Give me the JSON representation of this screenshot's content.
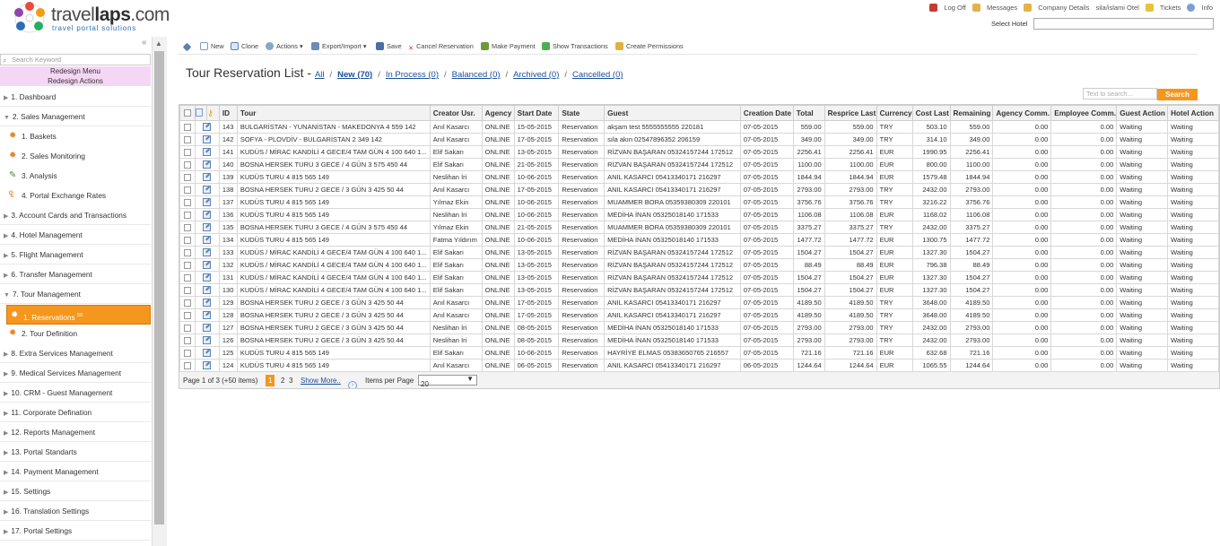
{
  "brand": {
    "name_light": "travel",
    "name_bold": "aps",
    "name_tail": ".com",
    "name_l": "l",
    "tagline": "travel portal solutions"
  },
  "top_links": [
    {
      "label": "Log Off",
      "icon": "power-icon",
      "color": "#c63b2d"
    },
    {
      "label": "Messages",
      "icon": "messages-icon",
      "color": "#e4b24a"
    },
    {
      "label": "Company Details",
      "icon": "company-icon",
      "color": "#e4b24a"
    },
    {
      "label": "sila/islami Otel",
      "icon": "",
      "color": ""
    },
    {
      "label": "Tickets",
      "icon": "warning-icon",
      "color": "#e8c33a"
    },
    {
      "label": "Info",
      "icon": "info-icon",
      "color": "#7b9fd0"
    }
  ],
  "select_hotel_label": "Select Hotel",
  "sidebar": {
    "search_placeholder": "Search Keyword",
    "redesign_menu": "Redesign Menu",
    "redesign_actions": "Redesign Actions",
    "items": [
      {
        "label": "1. Dashboard",
        "expanded": false
      },
      {
        "label": "2. Sales Management",
        "expanded": true
      },
      {
        "label": "3. Account Cards and Transactions",
        "expanded": false
      },
      {
        "label": "4. Hotel Management",
        "expanded": false
      },
      {
        "label": "5. Flight Management",
        "expanded": false
      },
      {
        "label": "6. Transfer Management",
        "expanded": false
      },
      {
        "label": "7. Tour Management",
        "expanded": true
      },
      {
        "label": "8. Extra Services Management",
        "expanded": false
      },
      {
        "label": "9. Medical Services Management",
        "expanded": false
      },
      {
        "label": "10. CRM - Guest Management",
        "expanded": false
      },
      {
        "label": "11. Corporate Defination",
        "expanded": false
      },
      {
        "label": "12. Reports Management",
        "expanded": false
      },
      {
        "label": "13. Portal Standarts",
        "expanded": false
      },
      {
        "label": "14. Payment Management",
        "expanded": false
      },
      {
        "label": "15. Settings",
        "expanded": false
      },
      {
        "label": "16. Translation Settings",
        "expanded": false
      },
      {
        "label": "17. Portal Settings",
        "expanded": false
      }
    ],
    "sales_sub": [
      "1. Baskets",
      "2. Sales Monitoring",
      "3. Analysis",
      "4. Portal Exchange Rates"
    ],
    "tour_sub": [
      {
        "label": "1. Reservations",
        "badge": "50"
      },
      {
        "label": "2. Tour Definition",
        "badge": ""
      }
    ]
  },
  "toolbar": {
    "new": "New",
    "clone": "Clone",
    "actions": "Actions",
    "export": "Export/Import",
    "save": "Save",
    "cancel": "Cancel Reservation",
    "make_payment": "Make Payment",
    "show_transactions": "Show Transactions",
    "create_permissions": "Create Permissions"
  },
  "page": {
    "title": "Tour Reservation List -",
    "filters": [
      {
        "label": "All",
        "bold": false
      },
      {
        "label": "New (70)",
        "bold": true
      },
      {
        "label": "In Process (0)",
        "bold": false
      },
      {
        "label": "Balanced (0)",
        "bold": false
      },
      {
        "label": "Archived (0)",
        "bold": false
      },
      {
        "label": "Cancelled (0)",
        "bold": false
      }
    ],
    "search_placeholder": "Text to search...",
    "search_button": "Search"
  },
  "table": {
    "columns": [
      "ID",
      "Tour",
      "Creator Usr.",
      "Agency",
      "Start Date",
      "State",
      "Guest",
      "Creation Date",
      "Total",
      "Resprice Last",
      "Currency",
      "Cost Last",
      "Remaining",
      "Agency Comm.",
      "Employee Comm.",
      "Guest Action",
      "Hotel Action"
    ],
    "rows": [
      [
        "143",
        "BULGARİSTAN - YUNANİSTAN - MAKEDONYA 4 559 142",
        "Anıl Kasarcı",
        "ONLINE",
        "15-05-2015",
        "Reservation",
        "akşam test 5555555555 220181",
        "07-05-2015",
        "559.00",
        "559.00",
        "TRY",
        "503.10",
        "559.00",
        "0.00",
        "0.00",
        "Waiting",
        "Waiting"
      ],
      [
        "142",
        "SOFYA - PLOVDİV - BULGARİSTAN 2 349 142",
        "Anıl Kasarcı",
        "ONLINE",
        "17-05-2015",
        "Reservation",
        "sıla akın 02547896352 206159",
        "07-05-2015",
        "349.00",
        "349.00",
        "TRY",
        "314.10",
        "349.00",
        "0.00",
        "0.00",
        "Waiting",
        "Waiting"
      ],
      [
        "141",
        "KUDÜS / MİRAC KANDİLİ 4 GECE/4 TAM GÜN 4 100 640 1...",
        "Elif Sakarı",
        "ONLINE",
        "13-05-2015",
        "Reservation",
        "RİZVAN BAŞARAN 05324157244 172512",
        "07-05-2015",
        "2256.41",
        "2256.41",
        "EUR",
        "1990.95",
        "2256.41",
        "0.00",
        "0.00",
        "Waiting",
        "Waiting"
      ],
      [
        "140",
        "BOSNA HERSEK TURU 3 GECE / 4 GÜN 3 575 450 44",
        "Elif Sakarı",
        "ONLINE",
        "21-05-2015",
        "Reservation",
        "RİZVAN BAŞARAN 05324157244 172512",
        "07-05-2015",
        "1100.00",
        "1100.00",
        "EUR",
        "800.00",
        "1100.00",
        "0.00",
        "0.00",
        "Waiting",
        "Waiting"
      ],
      [
        "139",
        "KUDÜS TURU 4 815 565 149",
        "Neslihan İri",
        "ONLINE",
        "10-06-2015",
        "Reservation",
        "ANIL KASARCI 05413340171 216297",
        "07-05-2015",
        "1844.94",
        "1844.94",
        "EUR",
        "1579.48",
        "1844.94",
        "0.00",
        "0.00",
        "Waiting",
        "Waiting"
      ],
      [
        "138",
        "BOSNA HERSEK TURU 2 GECE / 3 GÜN 3 425 50 44",
        "Anıl Kasarcı",
        "ONLINE",
        "17-05-2015",
        "Reservation",
        "ANIL KASARCI 05413340171 216297",
        "07-05-2015",
        "2793.00",
        "2793.00",
        "TRY",
        "2432.00",
        "2793.00",
        "0.00",
        "0.00",
        "Waiting",
        "Waiting"
      ],
      [
        "137",
        "KUDÜS TURU 4 815 565 149",
        "Yılmaz Ekin",
        "ONLINE",
        "10-06-2015",
        "Reservation",
        "MUAMMER BORA 05359380309 220101",
        "07-05-2015",
        "3756.76",
        "3756.76",
        "TRY",
        "3216.22",
        "3756.76",
        "0.00",
        "0.00",
        "Waiting",
        "Waiting"
      ],
      [
        "136",
        "KUDÜS TURU 4 815 565 149",
        "Neslihan İri",
        "ONLINE",
        "10-06-2015",
        "Reservation",
        "MEDİHA İNAN 05325018140 171533",
        "07-05-2015",
        "1106.08",
        "1106.08",
        "EUR",
        "1168.02",
        "1106.08",
        "0.00",
        "0.00",
        "Waiting",
        "Waiting"
      ],
      [
        "135",
        "BOSNA HERSEK TURU 3 GECE / 4 GÜN 3 575 450 44",
        "Yılmaz Ekin",
        "ONLINE",
        "21-05-2015",
        "Reservation",
        "MUAMMER BORA 05359380309 220101",
        "07-05-2015",
        "3375.27",
        "3375.27",
        "TRY",
        "2432.00",
        "3375.27",
        "0.00",
        "0.00",
        "Waiting",
        "Waiting"
      ],
      [
        "134",
        "KUDÜS TURU 4 815 565 149",
        "Fatma Yıldırım",
        "ONLINE",
        "10-06-2015",
        "Reservation",
        "MEDİHA İNAN 05325018140 171533",
        "07-05-2015",
        "1477.72",
        "1477.72",
        "EUR",
        "1300.75",
        "1477.72",
        "0.00",
        "0.00",
        "Waiting",
        "Waiting"
      ],
      [
        "133",
        "KUDÜS / MİRAC KANDİLİ 4 GECE/4 TAM GÜN 4 100 640 1...",
        "Elif Sakarı",
        "ONLINE",
        "13-05-2015",
        "Reservation",
        "RİZVAN BAŞARAN 05324157244 172512",
        "07-05-2015",
        "1504.27",
        "1504.27",
        "EUR",
        "1327.30",
        "1504.27",
        "0.00",
        "0.00",
        "Waiting",
        "Waiting"
      ],
      [
        "132",
        "KUDÜS / MİRAC KANDİLİ 4 GECE/4 TAM GÜN 4 100 640 1...",
        "Elif Sakarı",
        "ONLINE",
        "13-05-2015",
        "Reservation",
        "RİZVAN BAŞARAN 05324157244 172512",
        "07-05-2015",
        "88.49",
        "88.49",
        "EUR",
        "796.38",
        "88.49",
        "0.00",
        "0.00",
        "Waiting",
        "Waiting"
      ],
      [
        "131",
        "KUDÜS / MİRAC KANDİLİ 4 GECE/4 TAM GÜN 4 100 640 1...",
        "Elif Sakarı",
        "ONLINE",
        "13-05-2015",
        "Reservation",
        "RİZVAN BAŞARAN 05324157244 172512",
        "07-05-2015",
        "1504.27",
        "1504.27",
        "EUR",
        "1327.30",
        "1504.27",
        "0.00",
        "0.00",
        "Waiting",
        "Waiting"
      ],
      [
        "130",
        "KUDÜS / MİRAC KANDİLİ 4 GECE/4 TAM GÜN 4 100 640 1...",
        "Elif Sakarı",
        "ONLINE",
        "13-05-2015",
        "Reservation",
        "RİZVAN BAŞARAN 05324157244 172512",
        "07-05-2015",
        "1504.27",
        "1504.27",
        "EUR",
        "1327.30",
        "1504.27",
        "0.00",
        "0.00",
        "Waiting",
        "Waiting"
      ],
      [
        "129",
        "BOSNA HERSEK TURU 2 GECE / 3 GÜN 3 425 50 44",
        "Anıl Kasarcı",
        "ONLINE",
        "17-05-2015",
        "Reservation",
        "ANIL KASARCI 05413340171 216297",
        "07-05-2015",
        "4189.50",
        "4189.50",
        "TRY",
        "3648.00",
        "4189.50",
        "0.00",
        "0.00",
        "Waiting",
        "Waiting"
      ],
      [
        "128",
        "BOSNA HERSEK TURU 2 GECE / 3 GÜN 3 425 50 44",
        "Anıl Kasarcı",
        "ONLINE",
        "17-05-2015",
        "Reservation",
        "ANIL KASARCI 05413340171 216297",
        "07-05-2015",
        "4189.50",
        "4189.50",
        "TRY",
        "3648.00",
        "4189.50",
        "0.00",
        "0.00",
        "Waiting",
        "Waiting"
      ],
      [
        "127",
        "BOSNA HERSEK TURU 2 GECE / 3 GÜN 3 425 50 44",
        "Neslihan İri",
        "ONLINE",
        "08-05-2015",
        "Reservation",
        "MEDİHA İNAN 05325018140 171533",
        "07-05-2015",
        "2793.00",
        "2793.00",
        "TRY",
        "2432.00",
        "2793.00",
        "0.00",
        "0.00",
        "Waiting",
        "Waiting"
      ],
      [
        "126",
        "BOSNA HERSEK TURU 2 GECE / 3 GÜN 3 425 50 44",
        "Neslihan İri",
        "ONLINE",
        "08-05-2015",
        "Reservation",
        "MEDİHA İNAN 05325018140 171533",
        "07-05-2015",
        "2793.00",
        "2793.00",
        "TRY",
        "2432.00",
        "2793.00",
        "0.00",
        "0.00",
        "Waiting",
        "Waiting"
      ],
      [
        "125",
        "KUDÜS TURU 4 815 565 149",
        "Elif Sakarı",
        "ONLINE",
        "10-06-2015",
        "Reservation",
        "HAYRİYE ELMAS 05383650765 216557",
        "07-05-2015",
        "721.16",
        "721.16",
        "EUR",
        "632.68",
        "721.16",
        "0.00",
        "0.00",
        "Waiting",
        "Waiting"
      ],
      [
        "124",
        "KUDÜS TURU 4 815 565 149",
        "Anıl Kasarcı",
        "ONLINE",
        "06-05-2015",
        "Reservation",
        "ANIL KASARCI 05413340171 216297",
        "06-05-2015",
        "1244.64",
        "1244.64",
        "EUR",
        "1065.55",
        "1244.64",
        "0.00",
        "0.00",
        "Waiting",
        "Waiting"
      ]
    ]
  },
  "pager": {
    "page_info": "Page 1 of 3 (+50 items)",
    "pages": [
      "1",
      "2",
      "3"
    ],
    "show_more": "Show More..",
    "items_per_page_label": "Items per Page",
    "items_per_page": "20"
  }
}
